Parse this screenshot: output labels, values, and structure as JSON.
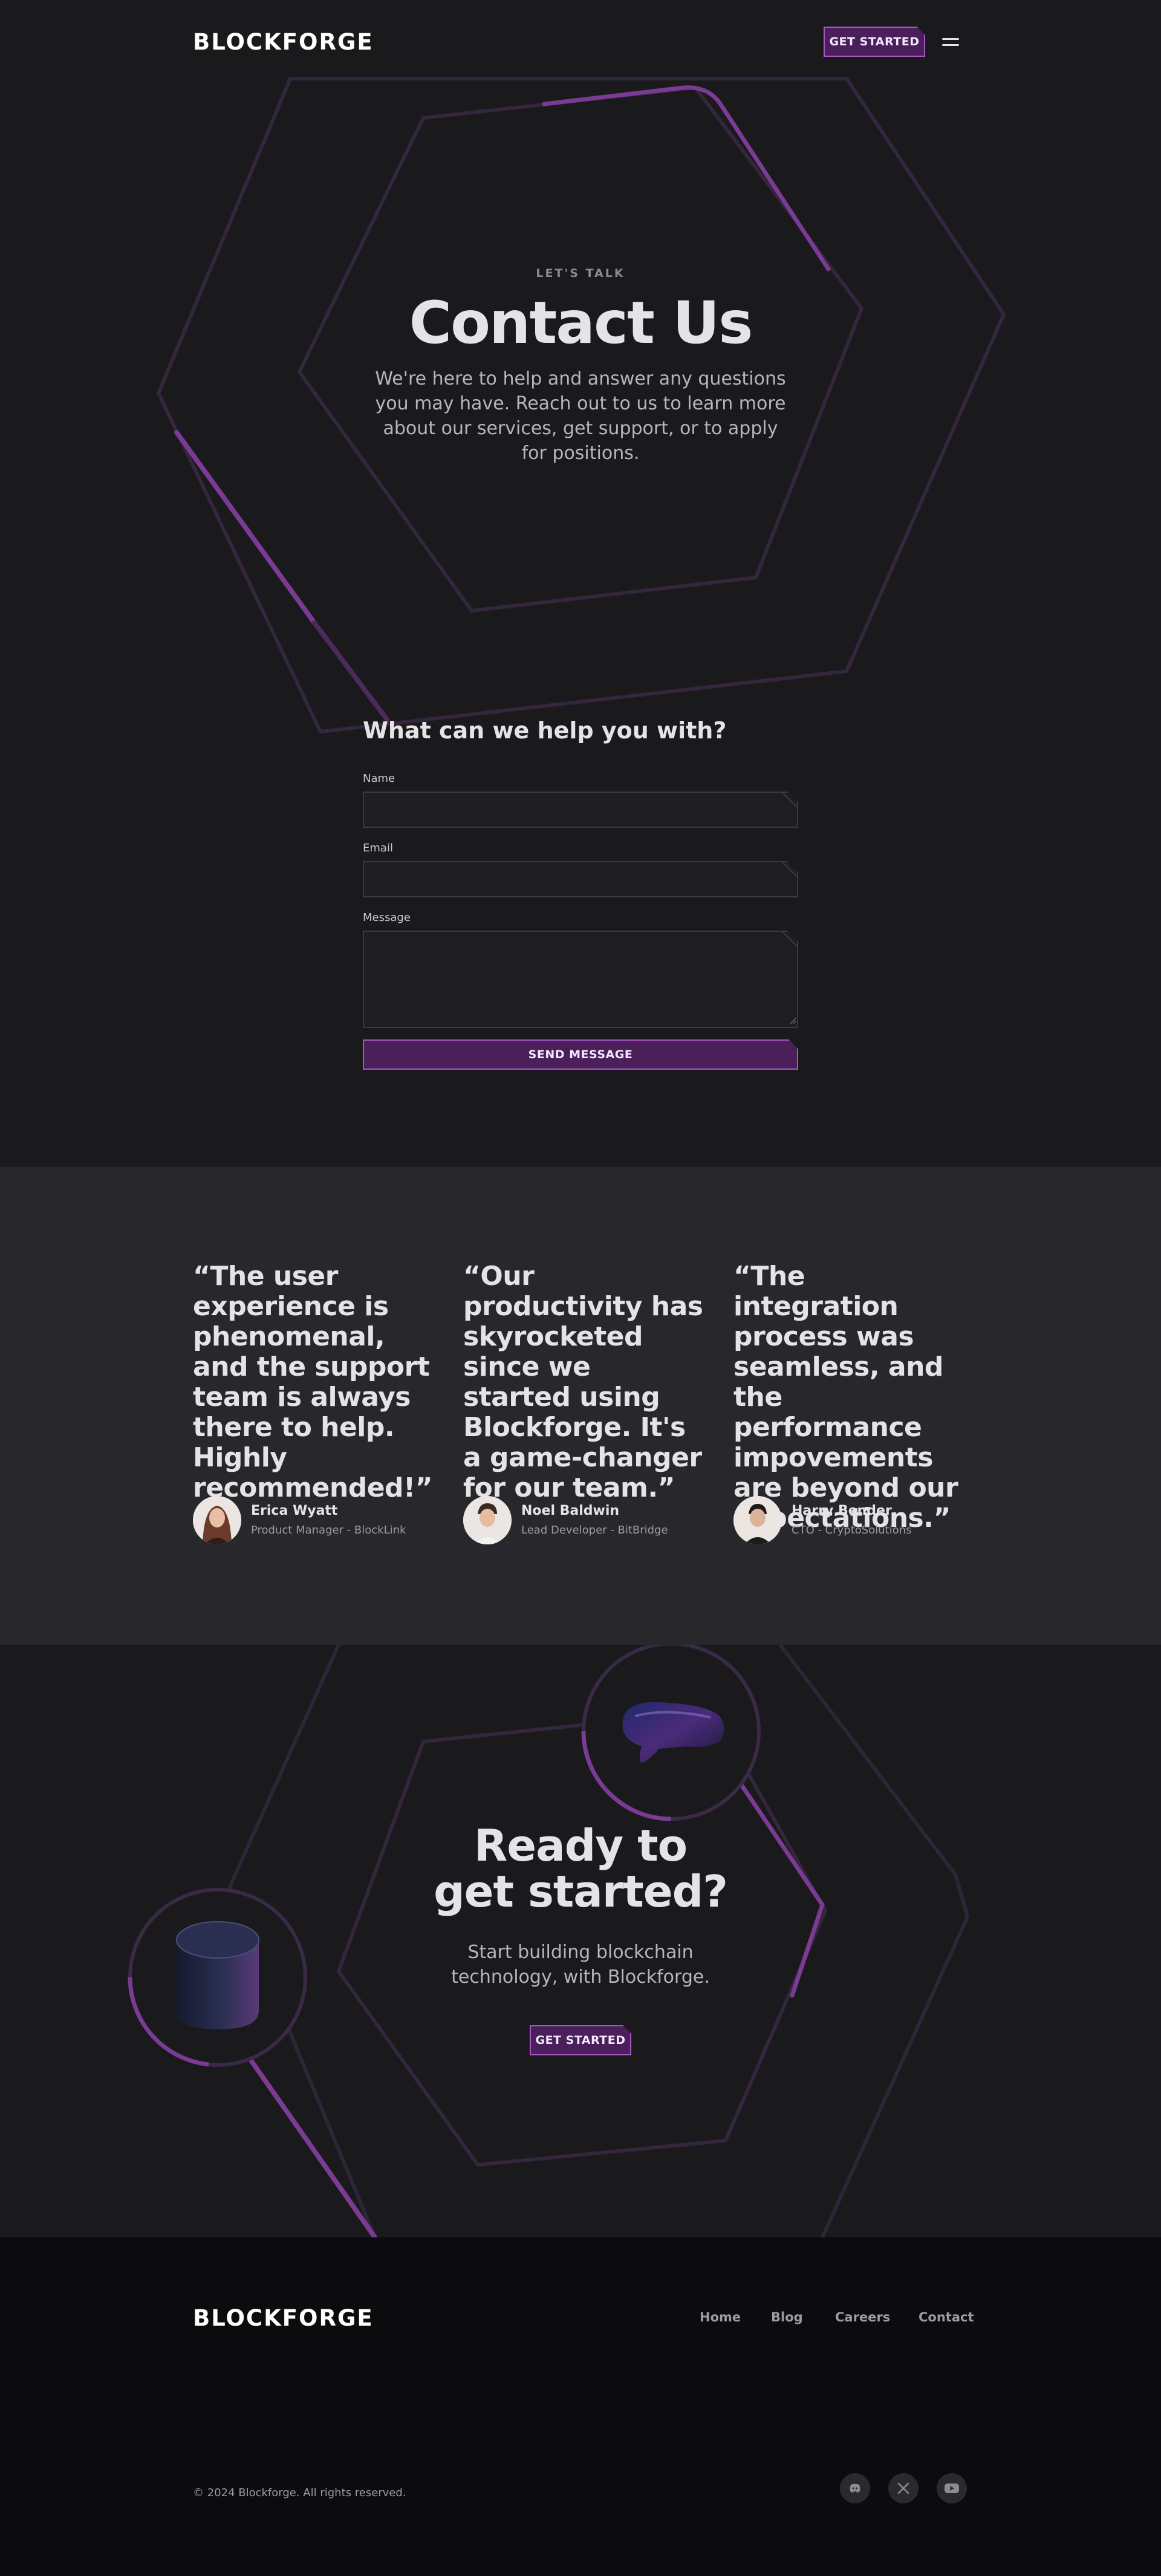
{
  "header": {
    "logo": "BLOCKFORGE",
    "cta_label": "GET STARTED",
    "menu_icon": "hamburger-menu-icon"
  },
  "hero": {
    "eyebrow": "LET'S TALK",
    "title": "Contact Us",
    "subtitle": "We're here to help and answer any questions you may have. Reach out to us to learn more about our services, get support, or to apply for positions."
  },
  "form": {
    "title": "What can we help you with?",
    "name_label": "Name",
    "name_value": "",
    "email_label": "Email",
    "email_value": "",
    "message_label": "Message",
    "message_value": "",
    "submit_label": "SEND MESSAGE"
  },
  "testimonials": [
    {
      "quote": "“The user experience is phenomenal, and the support team is always there to help. Highly recommended!”",
      "name": "Erica Wyatt",
      "role": "Product Manager - BlockLink"
    },
    {
      "quote": "“Our productivity has skyrocketed since we started using Blockforge. It's a game-changer for our team.”",
      "name": "Noel Baldwin",
      "role": "Lead Developer - BitBridge"
    },
    {
      "quote": "“The integration process was seamless, and the performance impovements are beyond our expectations.”",
      "name": "Harry Bender",
      "role": "CTO - CryptoSolutions"
    }
  ],
  "cta": {
    "title_line1": "Ready to",
    "title_line2": "get started?",
    "subtitle": "Start building blockchain technology, with Blockforge.",
    "button_label": "GET STARTED"
  },
  "footer": {
    "logo": "BLOCKFORGE",
    "nav": [
      "Home",
      "Blog",
      "Careers",
      "Contact"
    ],
    "copyright": "© 2024 Blockforge. All rights reserved.",
    "social_icons": [
      "discord-icon",
      "x-twitter-icon",
      "youtube-icon"
    ]
  },
  "colors": {
    "background": "#1a1a1d",
    "section_alt": "#28282c",
    "footer": "#0c0c0e",
    "accent": "#a855c7",
    "accent_fill": "#4a1f5a",
    "text": "#e4e4e7",
    "muted": "#9b9ba3"
  }
}
